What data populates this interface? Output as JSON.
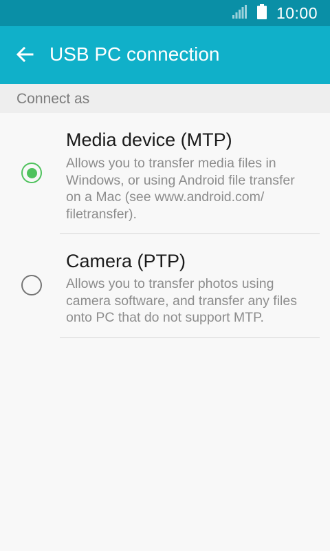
{
  "status_bar": {
    "time": "10:00",
    "icons": [
      "signal-icon",
      "battery-icon"
    ]
  },
  "app_bar": {
    "title": "USB PC connection",
    "back_icon": "back-arrow-icon"
  },
  "section": {
    "header": "Connect as"
  },
  "options": [
    {
      "title": "Media device (MTP)",
      "description_lines": [
        "Allows you to transfer media files in",
        "Windows, or using Android file transfer",
        "on a Mac (see www.android.com/",
        "filetransfer)."
      ],
      "selected": true
    },
    {
      "title": "Camera (PTP)",
      "description_lines": [
        "Allows you to transfer photos using",
        "camera software, and transfer any files",
        "onto PC that do not support MTP."
      ],
      "selected": false
    }
  ],
  "colors": {
    "status_bar": "#0a8fa6",
    "app_bar": "#10b0c9",
    "radio_selected": "#4fc25d",
    "radio_unselected": "#757575"
  }
}
